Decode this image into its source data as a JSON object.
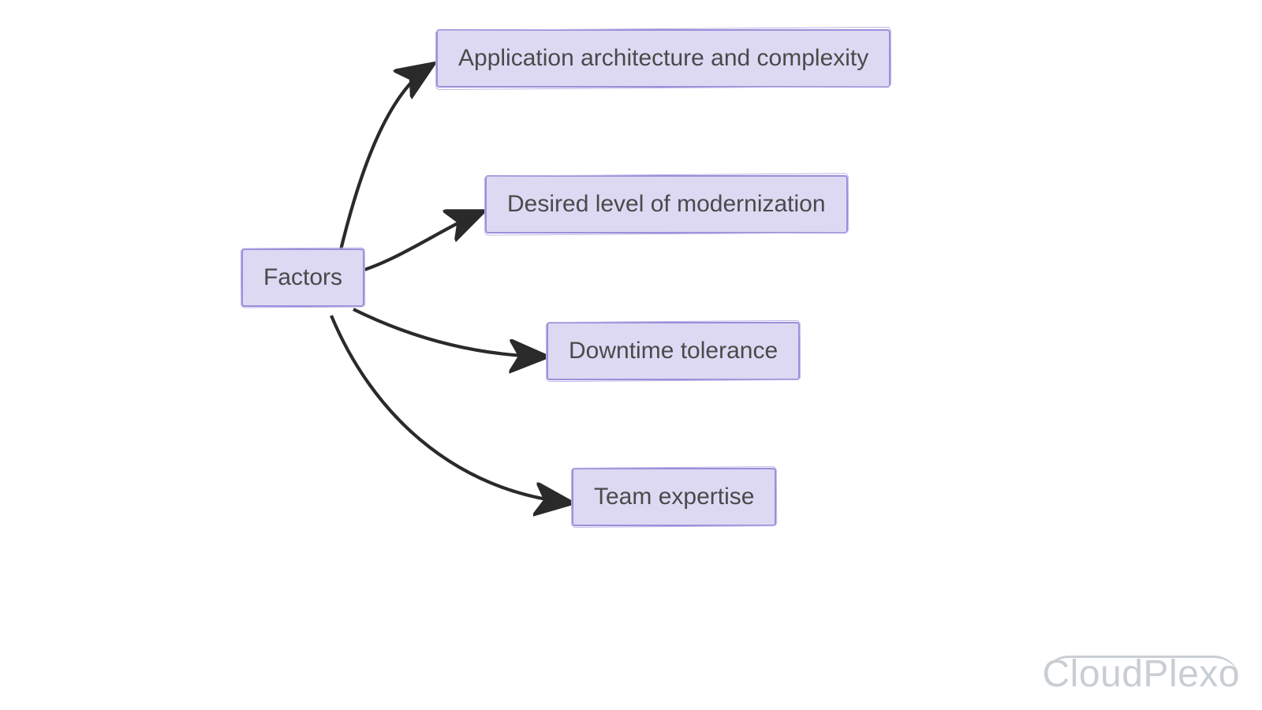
{
  "diagram": {
    "root": {
      "label": "Factors"
    },
    "children": [
      {
        "label": "Application architecture and complexity"
      },
      {
        "label": "Desired level of modernization"
      },
      {
        "label": "Downtime tolerance"
      },
      {
        "label": "Team expertise"
      }
    ]
  },
  "watermark": {
    "text": "CloudPlexo"
  },
  "colors": {
    "node_border": "#9a8fd9",
    "node_fill": "#ddd9f3",
    "edge": "#2a2a2a",
    "watermark": "#c9ced3"
  }
}
